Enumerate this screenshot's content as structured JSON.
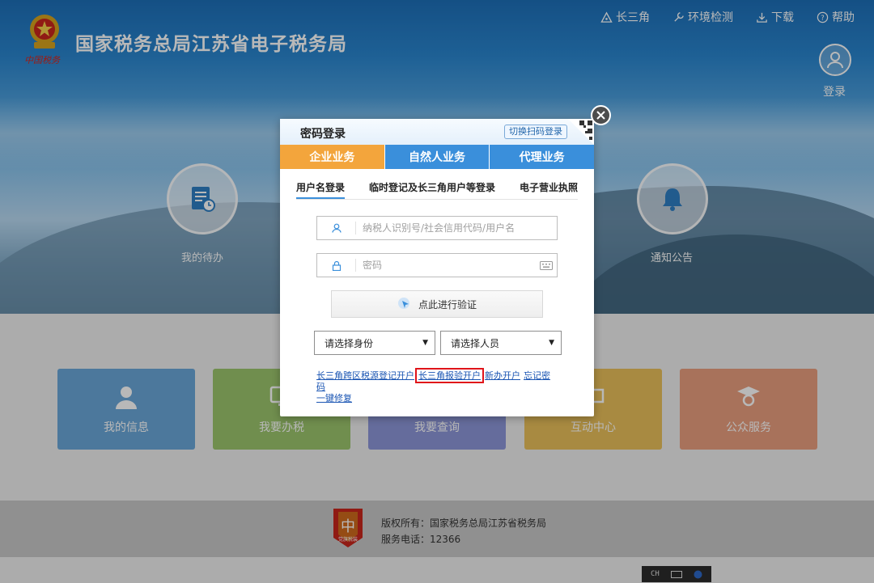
{
  "header": {
    "site_title": "国家税务总局江苏省电子税务局",
    "logo_sub": "中国税务",
    "links": [
      {
        "label": "长三角",
        "icon": "triangle-icon"
      },
      {
        "label": "环境检测",
        "icon": "wrench-icon"
      },
      {
        "label": "下载",
        "icon": "download-icon"
      },
      {
        "label": "帮助",
        "icon": "help-icon"
      }
    ],
    "login_label": "登录"
  },
  "background": {
    "circle_left_label": "我的待办",
    "circle_right_label": "通知公告",
    "tiles": [
      {
        "label": "我的信息",
        "color": "#6aa7d8"
      },
      {
        "label": "我要办税",
        "color": "#9bc56c"
      },
      {
        "label": "我要查询",
        "color": "#8d96d8"
      },
      {
        "label": "互动中心",
        "color": "#e9c05a"
      },
      {
        "label": "公众服务",
        "color": "#e99f7e"
      }
    ]
  },
  "footer": {
    "copyright": "版权所有：国家税务总局江苏省税务局",
    "phone": "服务电话：12366",
    "badge_text": "党旗税装"
  },
  "ime": {
    "label": "CH"
  },
  "modal": {
    "title": "密码登录",
    "switch_qr": "切换扫码登录",
    "biz_tabs": [
      "企业业务",
      "自然人业务",
      "代理业务"
    ],
    "login_tabs": [
      "用户名登录",
      "临时登记及长三角用户等登录",
      "电子营业执照"
    ],
    "username_placeholder": "纳税人识别号/社会信用代码/用户名",
    "password_placeholder": "密码",
    "verify_label": "点此进行验证",
    "select_identity": "请选择身份",
    "select_person": "请选择人员",
    "links": [
      "长三角跨区税源登记开户",
      "长三角报验开户",
      "新办开户",
      "忘记密码",
      "一键修复"
    ]
  }
}
